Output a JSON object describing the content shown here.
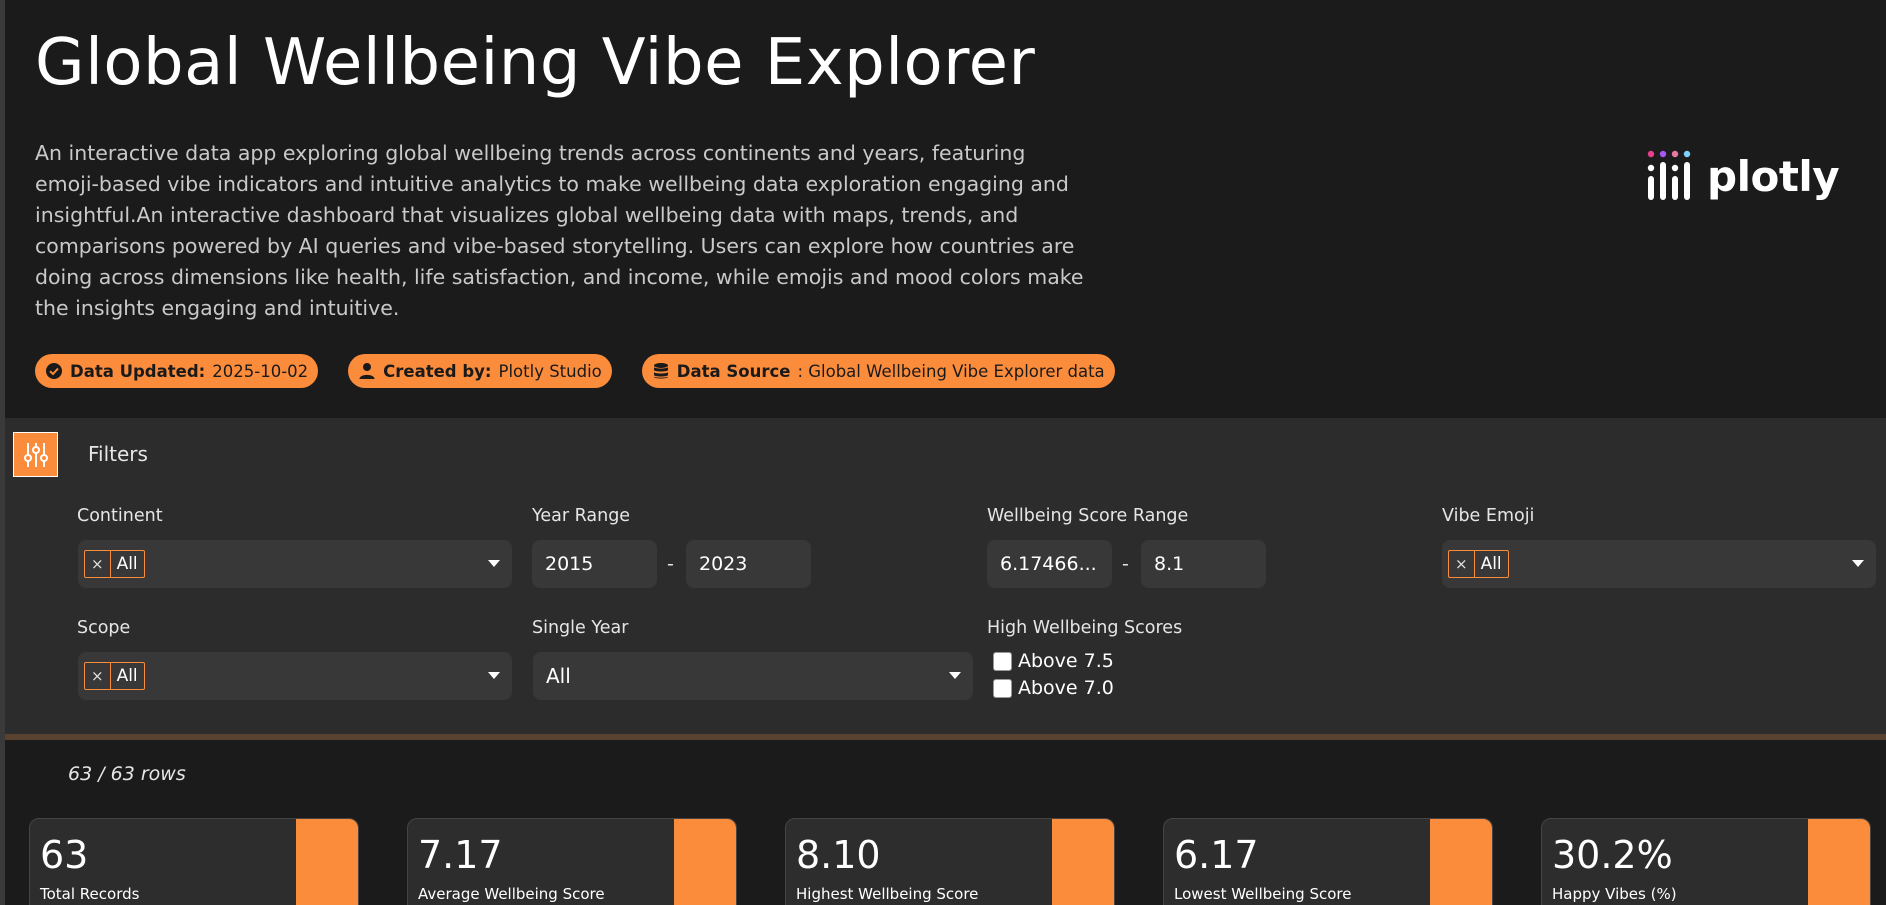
{
  "header": {
    "title": "Global Wellbeing Vibe Explorer",
    "description": "An interactive data app exploring global wellbeing trends across continents and years, featuring emoji-based vibe indicators and intuitive analytics to make wellbeing data exploration engaging and insightful.An interactive dashboard that visualizes global wellbeing data with maps, trends, and comparisons powered by AI queries and vibe-based storytelling. Users can explore how countries are doing across dimensions like health, life satisfaction, and income, while emojis and mood colors make the insights engaging and intuitive.",
    "logo_text": "plotly",
    "badges": [
      {
        "icon": "check-circle-icon",
        "key": "Data Updated:",
        "value": "2025-10-02"
      },
      {
        "icon": "user-icon",
        "key": "Created by:",
        "value": "Plotly Studio"
      },
      {
        "icon": "database-icon",
        "key": "Data Source",
        "value": ": Global Wellbeing Vibe Explorer data"
      }
    ]
  },
  "filters": {
    "title": "Filters",
    "continent": {
      "label": "Continent",
      "chip": "All",
      "remove": "×"
    },
    "year_range": {
      "label": "Year Range",
      "from": "2015",
      "sep": "-",
      "to": "2023"
    },
    "wellbeing_range": {
      "label": "Wellbeing Score Range",
      "from": "6.17466...",
      "sep": "-",
      "to": "8.1"
    },
    "vibe_emoji": {
      "label": "Vibe Emoji",
      "chip": "All",
      "remove": "×"
    },
    "scope": {
      "label": "Scope",
      "chip": "All",
      "remove": "×"
    },
    "single_year": {
      "label": "Single Year",
      "value": "All"
    },
    "high_wellbeing": {
      "label": "High Wellbeing Scores",
      "options": [
        "Above 7.5",
        "Above 7.0"
      ]
    }
  },
  "rows": "63 / 63 rows",
  "kpis": [
    {
      "value": "63",
      "label": "Total Records"
    },
    {
      "value": "7.17",
      "label": "Average Wellbeing Score"
    },
    {
      "value": "8.10",
      "label": "Highest Wellbeing Score"
    },
    {
      "value": "6.17",
      "label": "Lowest Wellbeing Score"
    },
    {
      "value": "30.2%",
      "label": "Happy Vibes (%)"
    }
  ],
  "colors": {
    "accent": "#fb8c3c",
    "background": "#1c1b1b",
    "panel": "#2d2c2c"
  }
}
